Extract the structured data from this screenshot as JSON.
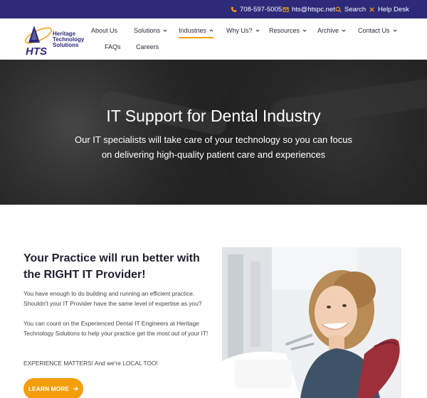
{
  "topbar": {
    "phone": "708-597-5005",
    "email": "hts@htspc.net",
    "search": "Search",
    "help": "Help Desk"
  },
  "logo": {
    "mark": "HTS",
    "line1": "Heritage",
    "line2": "Technology",
    "line3": "Solutions"
  },
  "nav": {
    "about": "About Us",
    "solutions": "Solutions",
    "industries": "Industries",
    "why": "Why Us?",
    "resources": "Resources",
    "archive": "Archive",
    "contact": "Contact Us",
    "faqs": "FAQs",
    "careers": "Careers"
  },
  "hero": {
    "title": "IT Support for Dental Industry",
    "subtitle": "Our IT specialists will take care of your technology so you can focus on delivering high-quality patient care and experiences"
  },
  "content": {
    "heading": "Your Practice will run better with the RIGHT IT Provider!",
    "p1": "You have enough to do building and running an efficient practice. Shouldn't your IT Provider have the same level of expertise as you?",
    "p2": "You can count on the Experienced Dental IT Engineers at Heritage Technology Solutions to help your practice get the most out of your IT!",
    "p3": "EXPERIENCE MATTERS! And we're LOCAL TOO!",
    "cta": "LEARN MORE"
  },
  "colors": {
    "topbar": "#2d2a7a",
    "accent": "#f59e0b",
    "brand": "#2d2a7a"
  }
}
